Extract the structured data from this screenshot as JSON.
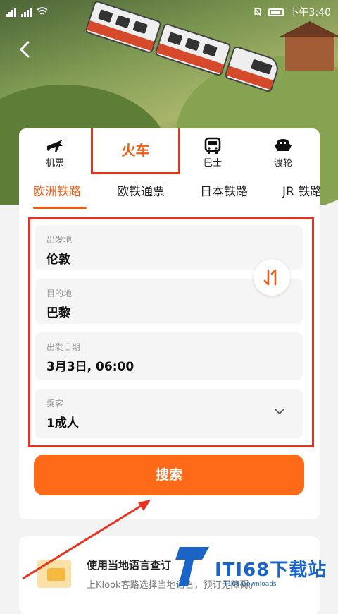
{
  "status_bar": {
    "time": "下午3:40"
  },
  "transport_modes": [
    {
      "label": "机票",
      "icon": "airplane-icon"
    },
    {
      "label": "火车",
      "icon": "train-icon"
    },
    {
      "label": "巴士",
      "icon": "bus-icon"
    },
    {
      "label": "渡轮",
      "icon": "ferry-icon"
    }
  ],
  "sub_tabs": [
    {
      "label": "欧洲铁路",
      "active": true
    },
    {
      "label": "欧铁通票"
    },
    {
      "label": "日本铁路"
    },
    {
      "label": "JR 铁路"
    }
  ],
  "form": {
    "origin": {
      "caption": "出发地",
      "value": "伦敦"
    },
    "destination": {
      "caption": "目的地",
      "value": "巴黎"
    },
    "date": {
      "caption": "出发日期",
      "value": "3月3日, 06:00"
    },
    "passengers": {
      "caption": "乘客",
      "value": "1成人"
    }
  },
  "search_label": "搜索",
  "promo": {
    "title": "使用当地语言查订",
    "description": "上Klook客路选择当地语言，预订无障碍。"
  },
  "watermark": {
    "text": "ITI68下载站",
    "sub": "IT168 Downloads"
  },
  "colors": {
    "accent": "#ff6a19",
    "highlight": "#e8321d"
  }
}
